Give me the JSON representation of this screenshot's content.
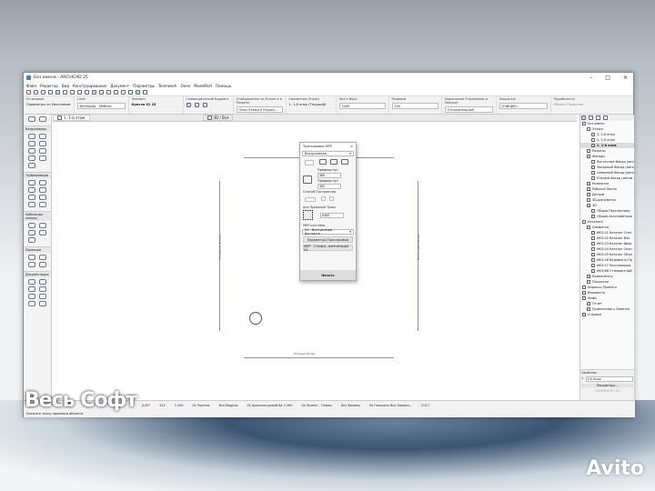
{
  "window": {
    "title": "Без имени - ARCHICAD 25",
    "minimize": "–",
    "maximize": "□",
    "close": "×"
  },
  "menu": [
    "Файл",
    "Редактор",
    "Вид",
    "Конструирование",
    "Документ",
    "Параметры",
    "Teamwork",
    "Окно",
    "ModelPort",
    "Помощь"
  ],
  "infobox": {
    "fields": [
      {
        "label": "Установки",
        "value": "Параметры по Умолчанию"
      },
      {
        "label": "Слой",
        "value": "Интерьер - Мебель"
      },
      {
        "label": "Элемент",
        "value": "Кресло 01 25"
      },
      {
        "label": "Геометрический Вариант",
        "value": ""
      },
      {
        "label": "Отображение на Плане и в Разрезе",
        "value": "План Этажа и Разрез..."
      },
      {
        "label": "Связанные Этажи",
        "value": "1. 1-й этаж (Текущий)"
      },
      {
        "label": "Низ и Верх",
        "value": "2400"
      },
      {
        "label": "Размеры",
        "value": "500"
      },
      {
        "label": "Зеркальное Отражение и Поворот",
        "value": "Относительный"
      },
      {
        "label": "Покрытие",
        "value": "ОЧИЩЕН..."
      },
      {
        "label": "Подобъекты",
        "value": "Объект Подогнан"
      }
    ]
  },
  "tabs": [
    {
      "label": "1. 1-й этаж"
    },
    {
      "label": "3D / Все"
    }
  ],
  "toolbox": {
    "groups": [
      "Воздуховоды",
      "Трубопроводы",
      "Кабельные каналы",
      "Проекции",
      "Документация"
    ]
  },
  "canvas": {
    "labels": [
      "Западный Фасад",
      "Восточный Фасад",
      "Южный Фасад"
    ]
  },
  "dialog": {
    "title": "Трассировка MEP",
    "system_type": "Воздуховоды",
    "offset_label": "Предвыступ",
    "offset_1": "300",
    "offset_2": "300",
    "routing_method": "Способ Построения",
    "reference_line": "оси Привязки Трасс",
    "elevation": "2400",
    "mep_system_label": "MEP-системы",
    "mep_system": "04 - Вентиляция - Вытяжка",
    "params_button": "Параметры Трассировки",
    "favorite": "MEP - Стояки...вентиляция 04",
    "start_button": "Начать"
  },
  "navigator": {
    "items": [
      {
        "label": "Без имени",
        "level": 0
      },
      {
        "label": "Этажи",
        "level": 1
      },
      {
        "label": "3. 3-й этаж",
        "level": 2
      },
      {
        "label": "2. 2-й этаж",
        "level": 2
      },
      {
        "label": "1. 1-й этаж",
        "level": 2,
        "current": true
      },
      {
        "label": "Разрезы",
        "level": 1
      },
      {
        "label": "Фасады",
        "level": 1
      },
      {
        "label": "Восточный Фасад (автом",
        "level": 2
      },
      {
        "label": "Западный Фасад (автом",
        "level": 2
      },
      {
        "label": "Северный Фасад (автом",
        "level": 2
      },
      {
        "label": "Южный Фасад (автом",
        "level": 2
      },
      {
        "label": "Развертки",
        "level": 1
      },
      {
        "label": "Рабочие Листы",
        "level": 1
      },
      {
        "label": "Детали",
        "level": 1
      },
      {
        "label": "3D-документы",
        "level": 1
      },
      {
        "label": "3D",
        "level": 1
      },
      {
        "label": "Общая Перспектива",
        "level": 2
      },
      {
        "label": "Общая Аксонометрия",
        "level": 2
      },
      {
        "label": "Каталоги",
        "level": 0
      },
      {
        "label": "Элементы",
        "level": 1
      },
      {
        "label": "ИКЭ-01 Каталог Стен",
        "level": 2
      },
      {
        "label": "ИКЭ-02 Каталог Вно",
        "level": 2
      },
      {
        "label": "ИКЭ-03 Каталог Двер",
        "level": 2
      },
      {
        "label": "ИКЭ-04 Каталог Окон",
        "level": 2
      },
      {
        "label": "ИКЭ-05 Каталог Объе",
        "level": 2
      },
      {
        "label": "ИКЭ-06 Ведомость Пр",
        "level": 2
      },
      {
        "label": "ИКЭ-07 Экспликация",
        "level": 2
      },
      {
        "label": "ИКЭ-ВК Стандартный",
        "level": 2
      },
      {
        "label": "Компоненты",
        "level": 1
      },
      {
        "label": "Покрытия",
        "level": 1
      },
      {
        "label": "Индексы Проекта",
        "level": 0
      },
      {
        "label": "Ведомость",
        "level": 0
      },
      {
        "label": "Инфо",
        "level": 0
      },
      {
        "label": "Отчет",
        "level": 1
      },
      {
        "label": "Примечания к Заметке",
        "level": 1
      },
      {
        "label": "Справка",
        "level": 0
      }
    ],
    "properties_label": "Свойства",
    "prop_id": "1",
    "prop_value": "1-й этаж",
    "params_button": "Параметры...",
    "brand": "GRAPHISOFT ID"
  },
  "status": {
    "items": [
      "0,00°",
      "522",
      "1:100",
      "02 Чертеж",
      "Вся Модель",
      "01 Архитектурный АА 1:100",
      "04 Проект - Планы",
      "Без Замены",
      "00 Показать Все Элемен...",
      "ГОСТ"
    ],
    "hint": "Укажите точку привязки объекта."
  },
  "watermark": "Весь Софт",
  "avito": "Avito"
}
